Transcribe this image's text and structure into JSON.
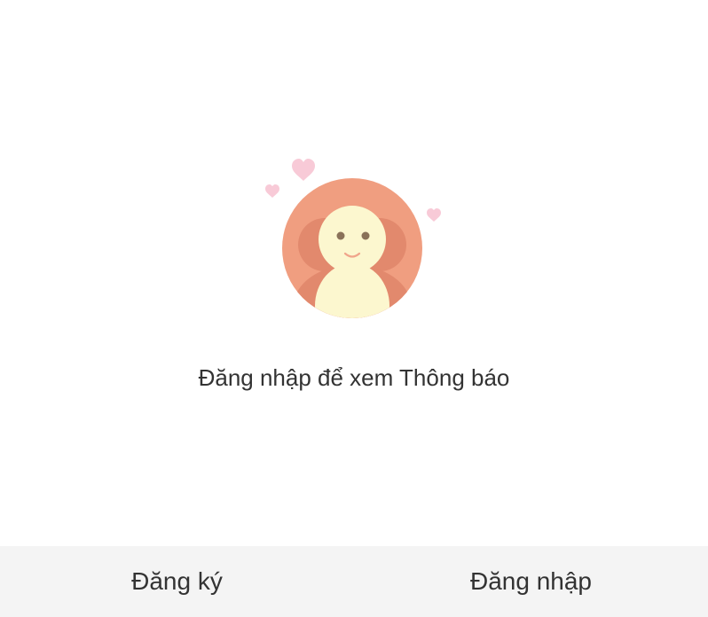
{
  "empty_state": {
    "illustration_icon": "avatar-with-hearts-icon",
    "message": "Đăng nhập để xem Thông báo"
  },
  "footer": {
    "register_label": "Đăng ký",
    "login_label": "Đăng nhập"
  },
  "colors": {
    "circle": "#F09E80",
    "figure": "#FCF7CF",
    "heart": "#F8CAD7",
    "footer_bg": "#F4F4F4"
  }
}
